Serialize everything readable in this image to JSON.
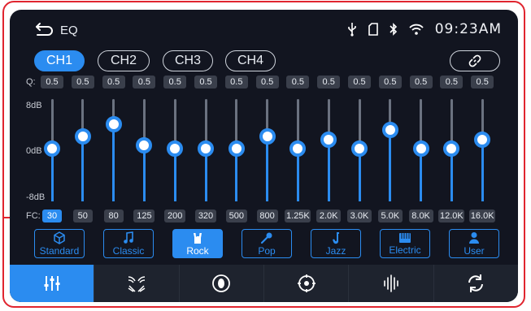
{
  "header": {
    "title": "EQ",
    "time": "09:23AM"
  },
  "channels": [
    "CH1",
    "CH2",
    "CH3",
    "CH4"
  ],
  "active_channel": 0,
  "q_label": "Q:",
  "q_values": [
    "0.5",
    "0.5",
    "0.5",
    "0.5",
    "0.5",
    "0.5",
    "0.5",
    "0.5",
    "0.5",
    "0.5",
    "0.5",
    "0.5",
    "0.5",
    "0.5",
    "0.5"
  ],
  "db_labels": {
    "top": "8dB",
    "mid": "0dB",
    "bottom": "-8dB"
  },
  "fc_label": "FC:",
  "frequencies": [
    "30",
    "50",
    "80",
    "125",
    "200",
    "320",
    "500",
    "800",
    "1.25K",
    "2.0K",
    "3.0K",
    "5.0K",
    "8.0K",
    "12.0K",
    "16.0K"
  ],
  "active_frequency": 0,
  "eq_levels": [
    0,
    2,
    4,
    0.5,
    0,
    0,
    0,
    2,
    0,
    1.5,
    0,
    3,
    0,
    0,
    1.5
  ],
  "presets": [
    {
      "label": "Standard",
      "icon": "cube-icon"
    },
    {
      "label": "Classic",
      "icon": "music-note-icon"
    },
    {
      "label": "Rock",
      "icon": "rock-hand-icon"
    },
    {
      "label": "Pop",
      "icon": "microphone-icon"
    },
    {
      "label": "Jazz",
      "icon": "saxophone-icon"
    },
    {
      "label": "Electric",
      "icon": "keyboard-icon"
    },
    {
      "label": "User",
      "icon": "user-icon"
    }
  ],
  "active_preset": 2,
  "bottom_nav": [
    {
      "icon": "equalizer-sliders-icon"
    },
    {
      "icon": "sound-field-icon"
    },
    {
      "icon": "speaker-icon"
    },
    {
      "icon": "balance-target-icon"
    },
    {
      "icon": "waveform-icon"
    },
    {
      "icon": "reset-refresh-icon"
    }
  ],
  "active_nav": 0,
  "colors": {
    "accent": "#2b8cf0",
    "background": "#121520",
    "frame": "#e0252f"
  }
}
